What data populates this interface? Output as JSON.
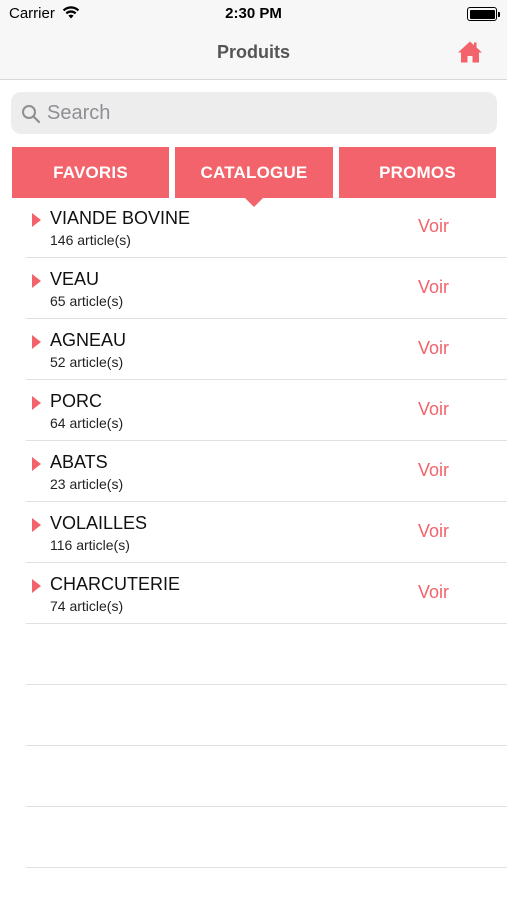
{
  "status_bar": {
    "carrier": "Carrier",
    "time": "2:30 PM"
  },
  "nav": {
    "title": "Produits",
    "home_icon": "home-icon"
  },
  "search": {
    "placeholder": "Search",
    "value": ""
  },
  "tabs": [
    {
      "label": "FAVORIS",
      "selected": false
    },
    {
      "label": "CATALOGUE",
      "selected": true
    },
    {
      "label": "PROMOS",
      "selected": false
    }
  ],
  "categories": [
    {
      "name": "VIANDE BOVINE",
      "count": "146 article(s)",
      "action": "Voir"
    },
    {
      "name": "VEAU",
      "count": "65 article(s)",
      "action": "Voir"
    },
    {
      "name": "AGNEAU",
      "count": "52 article(s)",
      "action": "Voir"
    },
    {
      "name": "PORC",
      "count": "64 article(s)",
      "action": "Voir"
    },
    {
      "name": "ABATS",
      "count": "23 article(s)",
      "action": "Voir"
    },
    {
      "name": "VOLAILLES",
      "count": "116 article(s)",
      "action": "Voir"
    },
    {
      "name": "CHARCUTERIE",
      "count": "74 article(s)",
      "action": "Voir"
    }
  ],
  "colors": {
    "accent": "#f2636b",
    "nav_background": "#f7f7f7",
    "search_background": "#ededee"
  }
}
